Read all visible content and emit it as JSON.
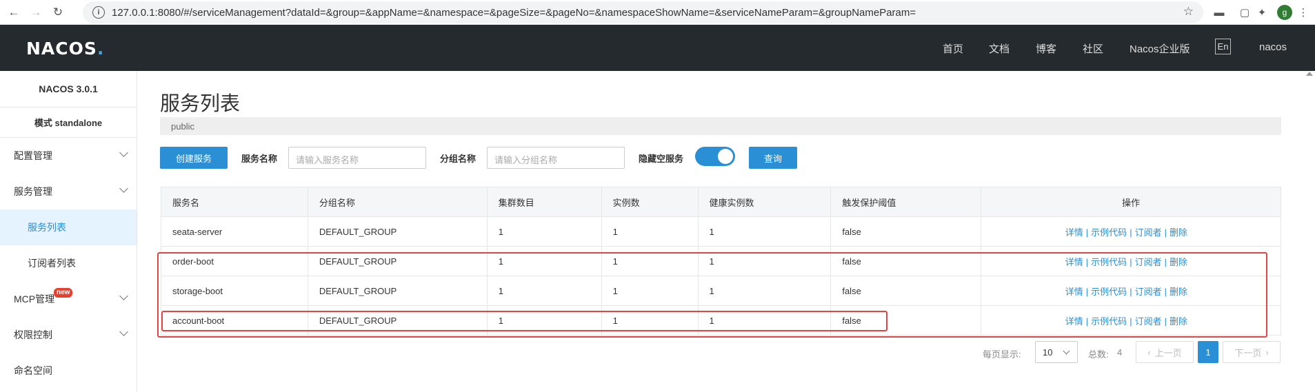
{
  "browser": {
    "url": "127.0.0.1:8080/#/serviceManagement?dataId=&group=&appName=&namespace=&pageSize=&pageNo=&namespaceShowName=&serviceNameParam=&groupNameParam=",
    "profile_initial": "g"
  },
  "topbar": {
    "logo_text": "NACOS",
    "logo_dot": ".",
    "nav": [
      "首页",
      "文档",
      "博客",
      "社区",
      "Nacos企业版"
    ],
    "lang": "En",
    "user": "nacos"
  },
  "sidebar": {
    "version": "NACOS 3.0.1",
    "mode": "模式 standalone",
    "items": [
      {
        "label": "配置管理"
      },
      {
        "label": "服务管理"
      },
      {
        "label": "服务列表"
      },
      {
        "label": "订阅者列表"
      },
      {
        "label": "MCP管理",
        "badge": "new"
      },
      {
        "label": "权限控制"
      },
      {
        "label": "命名空间"
      }
    ]
  },
  "main": {
    "title": "服务列表",
    "namespace": "public",
    "create_button": "创建服务",
    "service_name_label": "服务名称",
    "service_name_placeholder": "请输入服务名称",
    "group_name_label": "分组名称",
    "group_name_placeholder": "请输入分组名称",
    "hide_empty_label": "隐藏空服务",
    "hide_empty_on": true,
    "query_button": "查询"
  },
  "table": {
    "columns": [
      "服务名",
      "分组名称",
      "集群数目",
      "实例数",
      "健康实例数",
      "触发保护阈值",
      "操作"
    ],
    "actions": [
      "详情",
      "示例代码",
      "订阅者",
      "删除"
    ],
    "action_separator": "|",
    "rows": [
      [
        "seata-server",
        "DEFAULT_GROUP",
        "1",
        "1",
        "1",
        "false"
      ],
      [
        "order-boot",
        "DEFAULT_GROUP",
        "1",
        "1",
        "1",
        "false"
      ],
      [
        "storage-boot",
        "DEFAULT_GROUP",
        "1",
        "1",
        "1",
        "false"
      ],
      [
        "account-boot",
        "DEFAULT_GROUP",
        "1",
        "1",
        "1",
        "false"
      ]
    ]
  },
  "pagination": {
    "page_size_label": "每页显示:",
    "page_size": "10",
    "total_label": "总数:",
    "total": "4",
    "prev": "上一页",
    "current": "1",
    "next": "下一页"
  },
  "colors": {
    "accent": "#2a8fd4",
    "topbar": "#252a2f",
    "annotation": "#e24343"
  }
}
